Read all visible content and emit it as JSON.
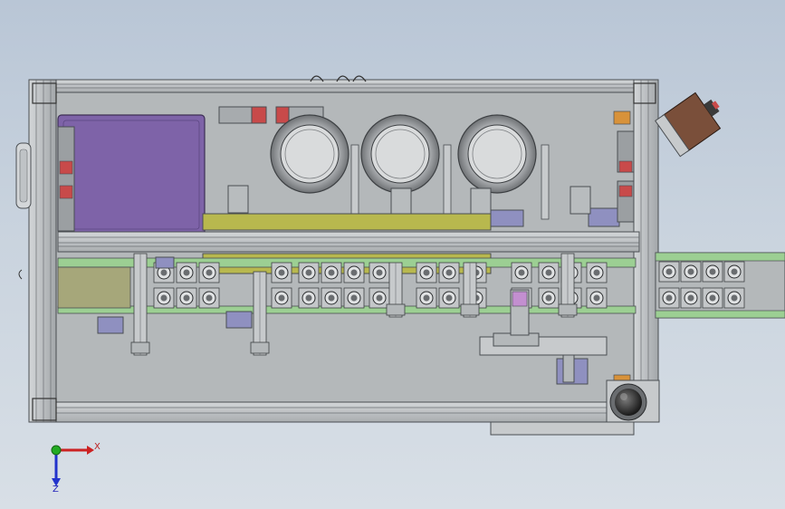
{
  "triad": {
    "x_label": "X",
    "z_label": "Z",
    "x_color": "#cc2222",
    "y_color": "#22aa22",
    "z_color": "#2233cc"
  },
  "colors": {
    "background_top": "#b9c6d6",
    "background_bottom": "#d8dfe6",
    "frame": "#bfc3c6",
    "frame_line": "#4a4e52",
    "plate": "#b4b8ba",
    "purple_panel": "#7e63a8",
    "yellow_bar": "#b8b84e",
    "green_rail": "#9ccf93",
    "blue_block": "#8f90c0",
    "red_accent": "#c84a4a",
    "brown_block": "#7a4f3a",
    "orange_accent": "#d8923a"
  },
  "view": {
    "description_icons": [
      "cad-assembly-icon",
      "coordinate-triad-icon"
    ]
  }
}
